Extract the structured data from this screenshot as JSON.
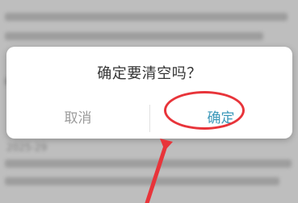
{
  "dialog": {
    "title": "确定要清空吗？",
    "cancel_label": "取消",
    "confirm_label": "确定"
  },
  "background": {
    "date_text": "2025-29"
  },
  "colors": {
    "confirm_text": "#3b98b9",
    "cancel_text": "#9b9b9b",
    "annotation": "#e8343a"
  }
}
